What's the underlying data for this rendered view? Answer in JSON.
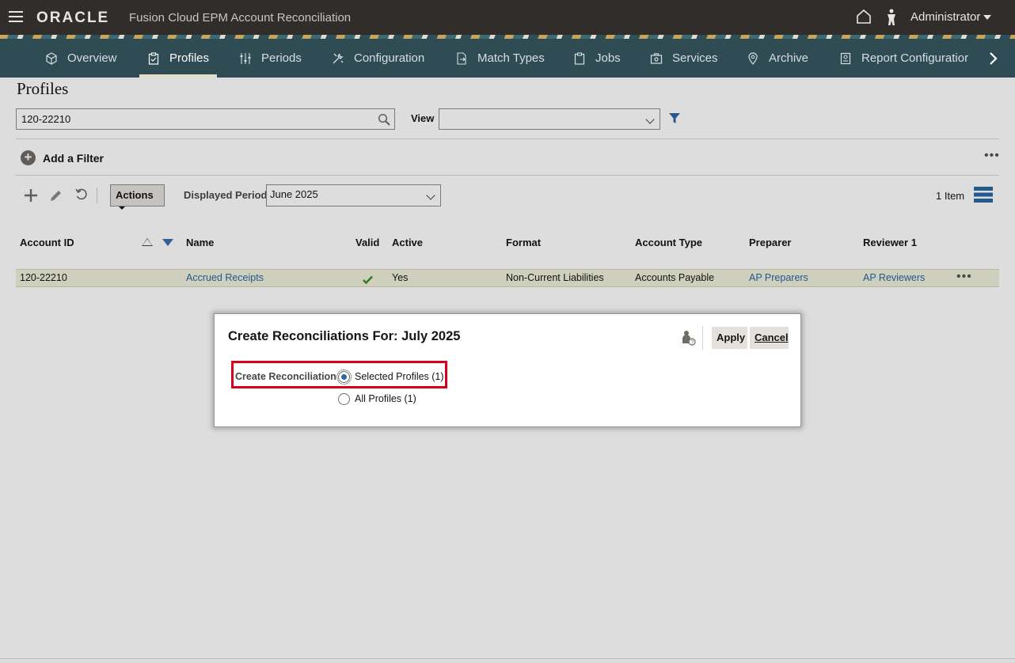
{
  "header": {
    "brand": "ORACLE",
    "app_title": "Fusion Cloud EPM Account Reconciliation",
    "user": "Administrator"
  },
  "nav": {
    "items": [
      {
        "label": "Overview",
        "icon": "cube-icon"
      },
      {
        "label": "Profiles",
        "icon": "clipboard-check-icon",
        "active": true
      },
      {
        "label": "Periods",
        "icon": "sliders-icon"
      },
      {
        "label": "Configuration",
        "icon": "tools-icon"
      },
      {
        "label": "Match Types",
        "icon": "document-arrow-icon"
      },
      {
        "label": "Jobs",
        "icon": "clipboard-icon"
      },
      {
        "label": "Services",
        "icon": "briefcase-gear-icon"
      },
      {
        "label": "Archive",
        "icon": "location-pin-icon"
      },
      {
        "label": "Report Configuratior",
        "icon": "report-icon"
      }
    ]
  },
  "page": {
    "title": "Profiles",
    "search_value": "120-22210",
    "view_label": "View",
    "view_value": "",
    "add_filter_label": "Add a Filter",
    "actions_label": "Actions",
    "displayed_period_label": "Displayed Period",
    "displayed_period_value": "June 2025",
    "item_count": "1 Item"
  },
  "table": {
    "headers": [
      "Account ID",
      "Name",
      "Valid",
      "Active",
      "Format",
      "Account Type",
      "Preparer",
      "Reviewer 1"
    ],
    "rows": [
      {
        "account_id": "120-22210",
        "name": "Accrued Receipts",
        "valid": true,
        "active": "Yes",
        "format": "Non-Current Liabilities",
        "account_type": "Accounts Payable",
        "preparer": "AP Preparers",
        "reviewer1": "AP Reviewers"
      }
    ]
  },
  "dialog": {
    "title": "Create Reconciliations For: July 2025",
    "apply_label": "Apply",
    "cancel_label": "Cancel",
    "field_label": "Create Reconciliation",
    "options": [
      {
        "label": "Selected Profiles (1)",
        "selected": true
      },
      {
        "label": "All Profiles (1)",
        "selected": false
      }
    ]
  },
  "colors": {
    "topbar": "#312d2a",
    "navbar": "#2f4b53",
    "link": "#2a67a3",
    "highlight_box": "#d6001c",
    "row_highlight": "#eeefda"
  }
}
